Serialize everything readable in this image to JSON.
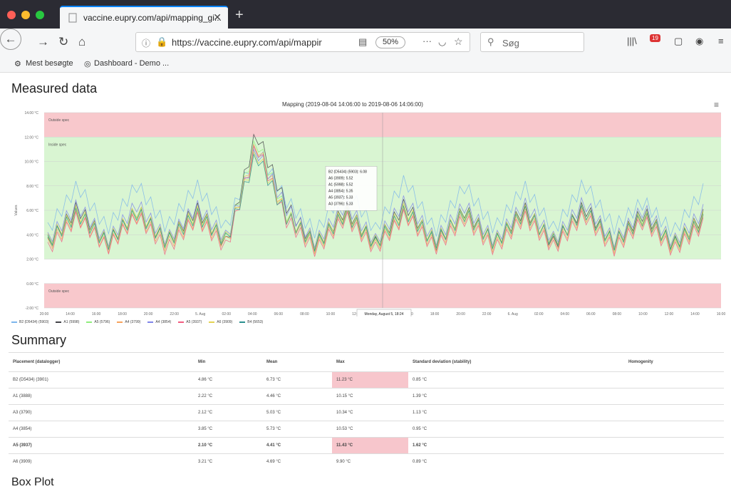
{
  "browser": {
    "tab_title": "vaccine.eupry.com/api/mapping_gi...",
    "tab_close": "✕",
    "new_tab": "+",
    "url": "https://vaccine.eupry.com/api/mappir",
    "zoom": "50%",
    "search_placeholder": "Søg",
    "bookmarks": [
      "Mest besøgte",
      "Dashboard - Demo ..."
    ],
    "notification_count": "19"
  },
  "page": {
    "title": "Measured data",
    "summary_title": "Summary",
    "boxplot_title": "Box Plot",
    "menu_glyph": "≡"
  },
  "chart_data": {
    "type": "line",
    "title": "Mapping (2019-08-04 14:06:00 to 2019-08-06 14:06:00)",
    "ylabel": "Values",
    "xlabel": "",
    "ylim": [
      -2,
      14
    ],
    "y_ticks": [
      "14.00 °C",
      "12.00 °C",
      "10.00 °C",
      "8.00 °C",
      "6.00 °C",
      "4.00 °C",
      "2.00 °C",
      "0.00 °C",
      "-2.00 °C"
    ],
    "x_ticks": [
      "20:00",
      "14:00",
      "16:00",
      "18:00",
      "20:00",
      "22:00",
      "5. Aug",
      "02:00",
      "04:00",
      "06:00",
      "08:00",
      "10:00",
      "12:00",
      "14:00",
      "16:00",
      "18:00",
      "20:00",
      "22:00",
      "6. Aug",
      "02:00",
      "04:00",
      "06:00",
      "08:00",
      "10:00",
      "12:00",
      "14:00",
      "16:00"
    ],
    "zones": [
      {
        "label": "Outside spec",
        "from": 12,
        "to": 14,
        "color": "#f8c8cc"
      },
      {
        "label": "Inside spec",
        "from": 2,
        "to": 12,
        "color": "#d9f5d2"
      },
      {
        "label": "Outside spec",
        "from": -2,
        "to": 0,
        "color": "#f8c8cc"
      }
    ],
    "series": [
      {
        "name": "B2 (D5434) (5903)",
        "color": "#7cb5ec",
        "values": [
          4.4,
          8.0,
          4.5,
          8.1,
          4.6,
          8.0,
          4.5,
          11.2,
          6.8,
          4.2,
          7.9,
          4.4,
          8.5,
          4.3,
          8.0,
          4.5,
          7.9,
          4.4,
          8.2,
          4.6,
          6.7,
          4.2,
          7.6
        ]
      },
      {
        "name": "A1 (5998)",
        "color": "#434348",
        "values": [
          3.2,
          6.2,
          3.3,
          6.0,
          3.4,
          6.1,
          3.2,
          12.4,
          6.4,
          3.1,
          6.1,
          3.2,
          6.5,
          3.2,
          6.0,
          3.3,
          6.1,
          3.2,
          6.3,
          3.3,
          5.8,
          3.1,
          5.5
        ]
      },
      {
        "name": "A5 (5796)",
        "color": "#90ed7d",
        "values": [
          3.3,
          5.8,
          3.2,
          5.9,
          3.3,
          5.7,
          3.4,
          11.8,
          5.7,
          3.0,
          5.8,
          3.1,
          6.0,
          3.3,
          5.9,
          3.2,
          5.8,
          3.4,
          6.0,
          3.2,
          5.6,
          3.0,
          5.2
        ]
      },
      {
        "name": "A4 (3799)",
        "color": "#f7a35c",
        "values": [
          3.1,
          5.5,
          3.0,
          5.6,
          3.1,
          5.4,
          3.2,
          11.5,
          5.5,
          2.9,
          5.6,
          3.0,
          5.7,
          3.1,
          5.5,
          3.0,
          5.6,
          3.1,
          5.8,
          3.0,
          5.3,
          2.9,
          5.0
        ]
      },
      {
        "name": "A4 (3854)",
        "color": "#8085e9",
        "values": [
          3.6,
          6.4,
          3.5,
          6.5,
          3.6,
          6.3,
          3.7,
          11.0,
          6.2,
          3.4,
          6.5,
          3.5,
          6.8,
          3.6,
          6.4,
          3.5,
          6.5,
          3.6,
          6.7,
          3.5,
          6.1,
          3.4,
          5.9
        ]
      },
      {
        "name": "A5 (3937)",
        "color": "#f15c80",
        "values": [
          2.8,
          5.4,
          2.9,
          5.5,
          2.8,
          5.3,
          2.9,
          11.4,
          5.2,
          2.7,
          5.4,
          2.8,
          5.6,
          2.9,
          5.3,
          2.8,
          5.4,
          2.9,
          5.6,
          2.8,
          5.1,
          2.7,
          4.8
        ]
      },
      {
        "name": "A6 (3909)",
        "color": "#e4d354",
        "values": [
          3.5,
          5.9,
          3.4,
          6.0,
          3.5,
          5.8,
          3.6,
          10.8,
          5.6,
          3.3,
          5.9,
          3.4,
          6.1,
          3.5,
          5.8,
          3.4,
          5.9,
          3.5,
          6.0,
          3.4,
          5.5,
          3.3,
          5.3
        ]
      },
      {
        "name": "B4 (5653)",
        "color": "#2b908f",
        "values": [
          3.4,
          5.7,
          3.3,
          5.8,
          3.4,
          5.6,
          3.5,
          10.6,
          5.5,
          3.2,
          5.7,
          3.3,
          5.9,
          3.4,
          5.7,
          3.3,
          5.8,
          3.4,
          6.0,
          3.3,
          5.4,
          3.2,
          5.1
        ]
      }
    ],
    "tooltip": {
      "lines": [
        "B2 (D5434) (5903): 6.08",
        "A6 (3909): 5.52",
        "A1 (5998): 5.52",
        "A4 (3854): 5.35",
        "A5 (3937): 5.33",
        "A3 (3796): 5.33"
      ],
      "footer": "Monday, August 5, 18:24"
    }
  },
  "summary": {
    "headers": [
      "Placement (datalogger)",
      "Min",
      "Mean",
      "Max",
      "Standard deviation (stability)",
      "Homogenity"
    ],
    "rows": [
      {
        "cells": [
          "B2 (D5434) (3901)",
          "4.86 °C",
          "6.73 °C",
          "11.23 °C",
          "0.85 °C",
          ""
        ],
        "highlight_max": true,
        "bold": false
      },
      {
        "cells": [
          "A1 (3888)",
          "2.22 °C",
          "4.46 °C",
          "10.15 °C",
          "1.39 °C",
          ""
        ],
        "highlight_max": false,
        "bold": false
      },
      {
        "cells": [
          "A3 (3790)",
          "2.12 °C",
          "5.03 °C",
          "10.34 °C",
          "1.13 °C",
          ""
        ],
        "highlight_max": false,
        "bold": false
      },
      {
        "cells": [
          "A4 (3854)",
          "3.85 °C",
          "5.73 °C",
          "10.53 °C",
          "0.95 °C",
          ""
        ],
        "highlight_max": false,
        "bold": false
      },
      {
        "cells": [
          "A5 (3937)",
          "2.10 °C",
          "4.41 °C",
          "11.43 °C",
          "1.62 °C",
          ""
        ],
        "highlight_max": true,
        "bold": true
      },
      {
        "cells": [
          "A6 (3909)",
          "3.21 °C",
          "4.69 °C",
          "9.90 °C",
          "0.89 °C",
          ""
        ],
        "highlight_max": false,
        "bold": false
      }
    ]
  },
  "colors": {
    "accent": "#0a84ff",
    "out_spec": "#f8c8cc",
    "in_spec": "#d9f5d2",
    "highlight": "#f7c6cc"
  }
}
